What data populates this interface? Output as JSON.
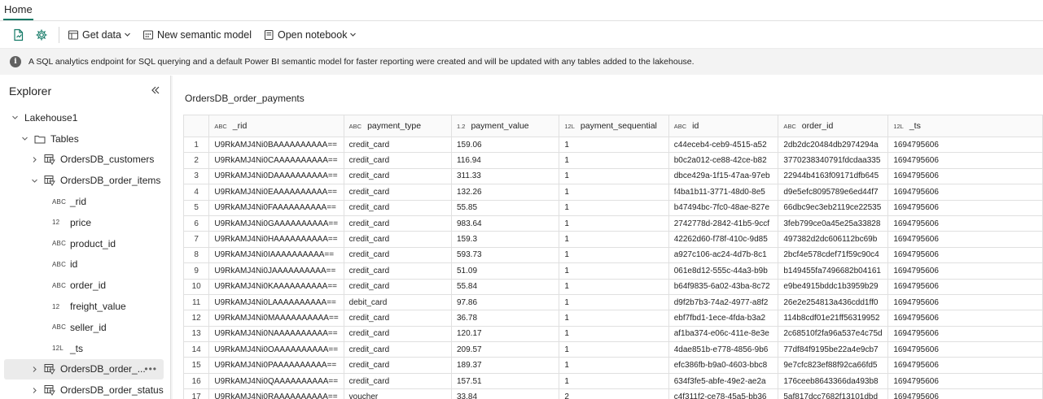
{
  "tabs": {
    "home": "Home"
  },
  "toolbar": {
    "get_data": "Get data",
    "new_semantic_model": "New semantic model",
    "open_notebook": "Open notebook"
  },
  "info": {
    "message": "A SQL analytics endpoint for SQL querying and a default Power BI semantic model for faster reporting were created and will be updated with any tables added to the lakehouse."
  },
  "explorer": {
    "title": "Explorer",
    "lakehouse": "Lakehouse1",
    "tables_label": "Tables",
    "customers": "OrdersDB_customers",
    "order_items": "OrdersDB_order_items",
    "columns": [
      {
        "type": "ABC",
        "name": "_rid"
      },
      {
        "type": "12",
        "name": "price"
      },
      {
        "type": "ABC",
        "name": "product_id"
      },
      {
        "type": "ABC",
        "name": "id"
      },
      {
        "type": "ABC",
        "name": "order_id"
      },
      {
        "type": "12",
        "name": "freight_value"
      },
      {
        "type": "ABC",
        "name": "seller_id"
      },
      {
        "type": "12L",
        "name": "_ts"
      }
    ],
    "selected_table": "OrdersDB_order_...",
    "order_status": "OrdersDB_order_status"
  },
  "table": {
    "title": "OrdersDB_order_payments",
    "headers": [
      {
        "type": "ABC",
        "name": "_rid"
      },
      {
        "type": "ABC",
        "name": "payment_type"
      },
      {
        "type": "1.2",
        "name": "payment_value"
      },
      {
        "type": "12L",
        "name": "payment_sequential"
      },
      {
        "type": "ABC",
        "name": "id"
      },
      {
        "type": "ABC",
        "name": "order_id"
      },
      {
        "type": "12L",
        "name": "_ts"
      }
    ],
    "rows": [
      [
        "1",
        "U9RkAMJ4Ni0BAAAAAAAAAA==",
        "credit_card",
        "159.06",
        "1",
        "c44eceb4-ceb9-4515-a52",
        "2db2dc20484db2974294a",
        "1694795606"
      ],
      [
        "2",
        "U9RkAMJ4Ni0CAAAAAAAAAA==",
        "credit_card",
        "116.94",
        "1",
        "b0c2a012-ce88-42ce-b82",
        "3770238340791fdcdaa335",
        "1694795606"
      ],
      [
        "3",
        "U9RkAMJ4Ni0DAAAAAAAAAA==",
        "credit_card",
        "311.33",
        "1",
        "dbce429a-1f15-47aa-97eb",
        "22944b4163f09171dfb645",
        "1694795606"
      ],
      [
        "4",
        "U9RkAMJ4Ni0EAAAAAAAAAA==",
        "credit_card",
        "132.26",
        "1",
        "f4ba1b11-3771-48d0-8e5",
        "d9e5efc8095789e6ed44f7",
        "1694795606"
      ],
      [
        "5",
        "U9RkAMJ4Ni0FAAAAAAAAAA==",
        "credit_card",
        "55.85",
        "1",
        "b47494bc-7fc0-48ae-827e",
        "66dbc9ec3eb2119ce22535",
        "1694795606"
      ],
      [
        "6",
        "U9RkAMJ4Ni0GAAAAAAAAAA==",
        "credit_card",
        "983.64",
        "1",
        "2742778d-2842-41b5-9ccf",
        "3feb799ce0a45e25a33828",
        "1694795606"
      ],
      [
        "7",
        "U9RkAMJ4Ni0HAAAAAAAAAA==",
        "credit_card",
        "159.3",
        "1",
        "42262d60-f78f-410c-9d85",
        "497382d2dc606112bc69b",
        "1694795606"
      ],
      [
        "8",
        "U9RkAMJ4Ni0IAAAAAAAAAA==",
        "credit_card",
        "593.73",
        "1",
        "a927c106-ac24-4d7b-8c1",
        "2bcf4e578cdef71f59c90c4",
        "1694795606"
      ],
      [
        "9",
        "U9RkAMJ4Ni0JAAAAAAAAAA==",
        "credit_card",
        "51.09",
        "1",
        "061e8d12-555c-44a3-b9b",
        "b149455fa7496682b04161",
        "1694795606"
      ],
      [
        "10",
        "U9RkAMJ4Ni0KAAAAAAAAAA==",
        "credit_card",
        "55.84",
        "1",
        "b64f9835-6a02-43ba-8c72",
        "e9be4915bddc1b3959b29",
        "1694795606"
      ],
      [
        "11",
        "U9RkAMJ4Ni0LAAAAAAAAAA==",
        "debit_card",
        "97.86",
        "1",
        "d9f2b7b3-74a2-4977-a8f2",
        "26e2e254813a436cdd1ff0",
        "1694795606"
      ],
      [
        "12",
        "U9RkAMJ4Ni0MAAAAAAAAAA==",
        "credit_card",
        "36.78",
        "1",
        "ebf7fbd1-1ece-4fda-b3a2",
        "114b8cdf01e21ff56319952",
        "1694795606"
      ],
      [
        "13",
        "U9RkAMJ4Ni0NAAAAAAAAAA==",
        "credit_card",
        "120.17",
        "1",
        "af1ba374-e06c-411e-8e3e",
        "2c68510f2fa96a537e4c75d",
        "1694795606"
      ],
      [
        "14",
        "U9RkAMJ4Ni0OAAAAAAAAAA==",
        "credit_card",
        "209.57",
        "1",
        "4dae851b-e778-4856-9b6",
        "77df84f9195be22a4e9cb7",
        "1694795606"
      ],
      [
        "15",
        "U9RkAMJ4Ni0PAAAAAAAAAA==",
        "credit_card",
        "189.37",
        "1",
        "efc386fb-b9a0-4603-bbc8",
        "9e7cfc823ef88f92ca66fd5",
        "1694795606"
      ],
      [
        "16",
        "U9RkAMJ4Ni0QAAAAAAAAAA==",
        "credit_card",
        "157.51",
        "1",
        "634f3fe5-abfe-49e2-ae2a",
        "176ceeb8643366da493b8",
        "1694795606"
      ],
      [
        "17",
        "U9RkAMJ4Ni0RAAAAAAAAAA==",
        "voucher",
        "33.84",
        "2",
        "c4f311f2-ce78-45a5-bb36",
        "5af817dcc7682f13101dbd",
        "1694795606"
      ]
    ]
  },
  "colors": {
    "accent": "#117865",
    "icon_green": "#117865"
  }
}
